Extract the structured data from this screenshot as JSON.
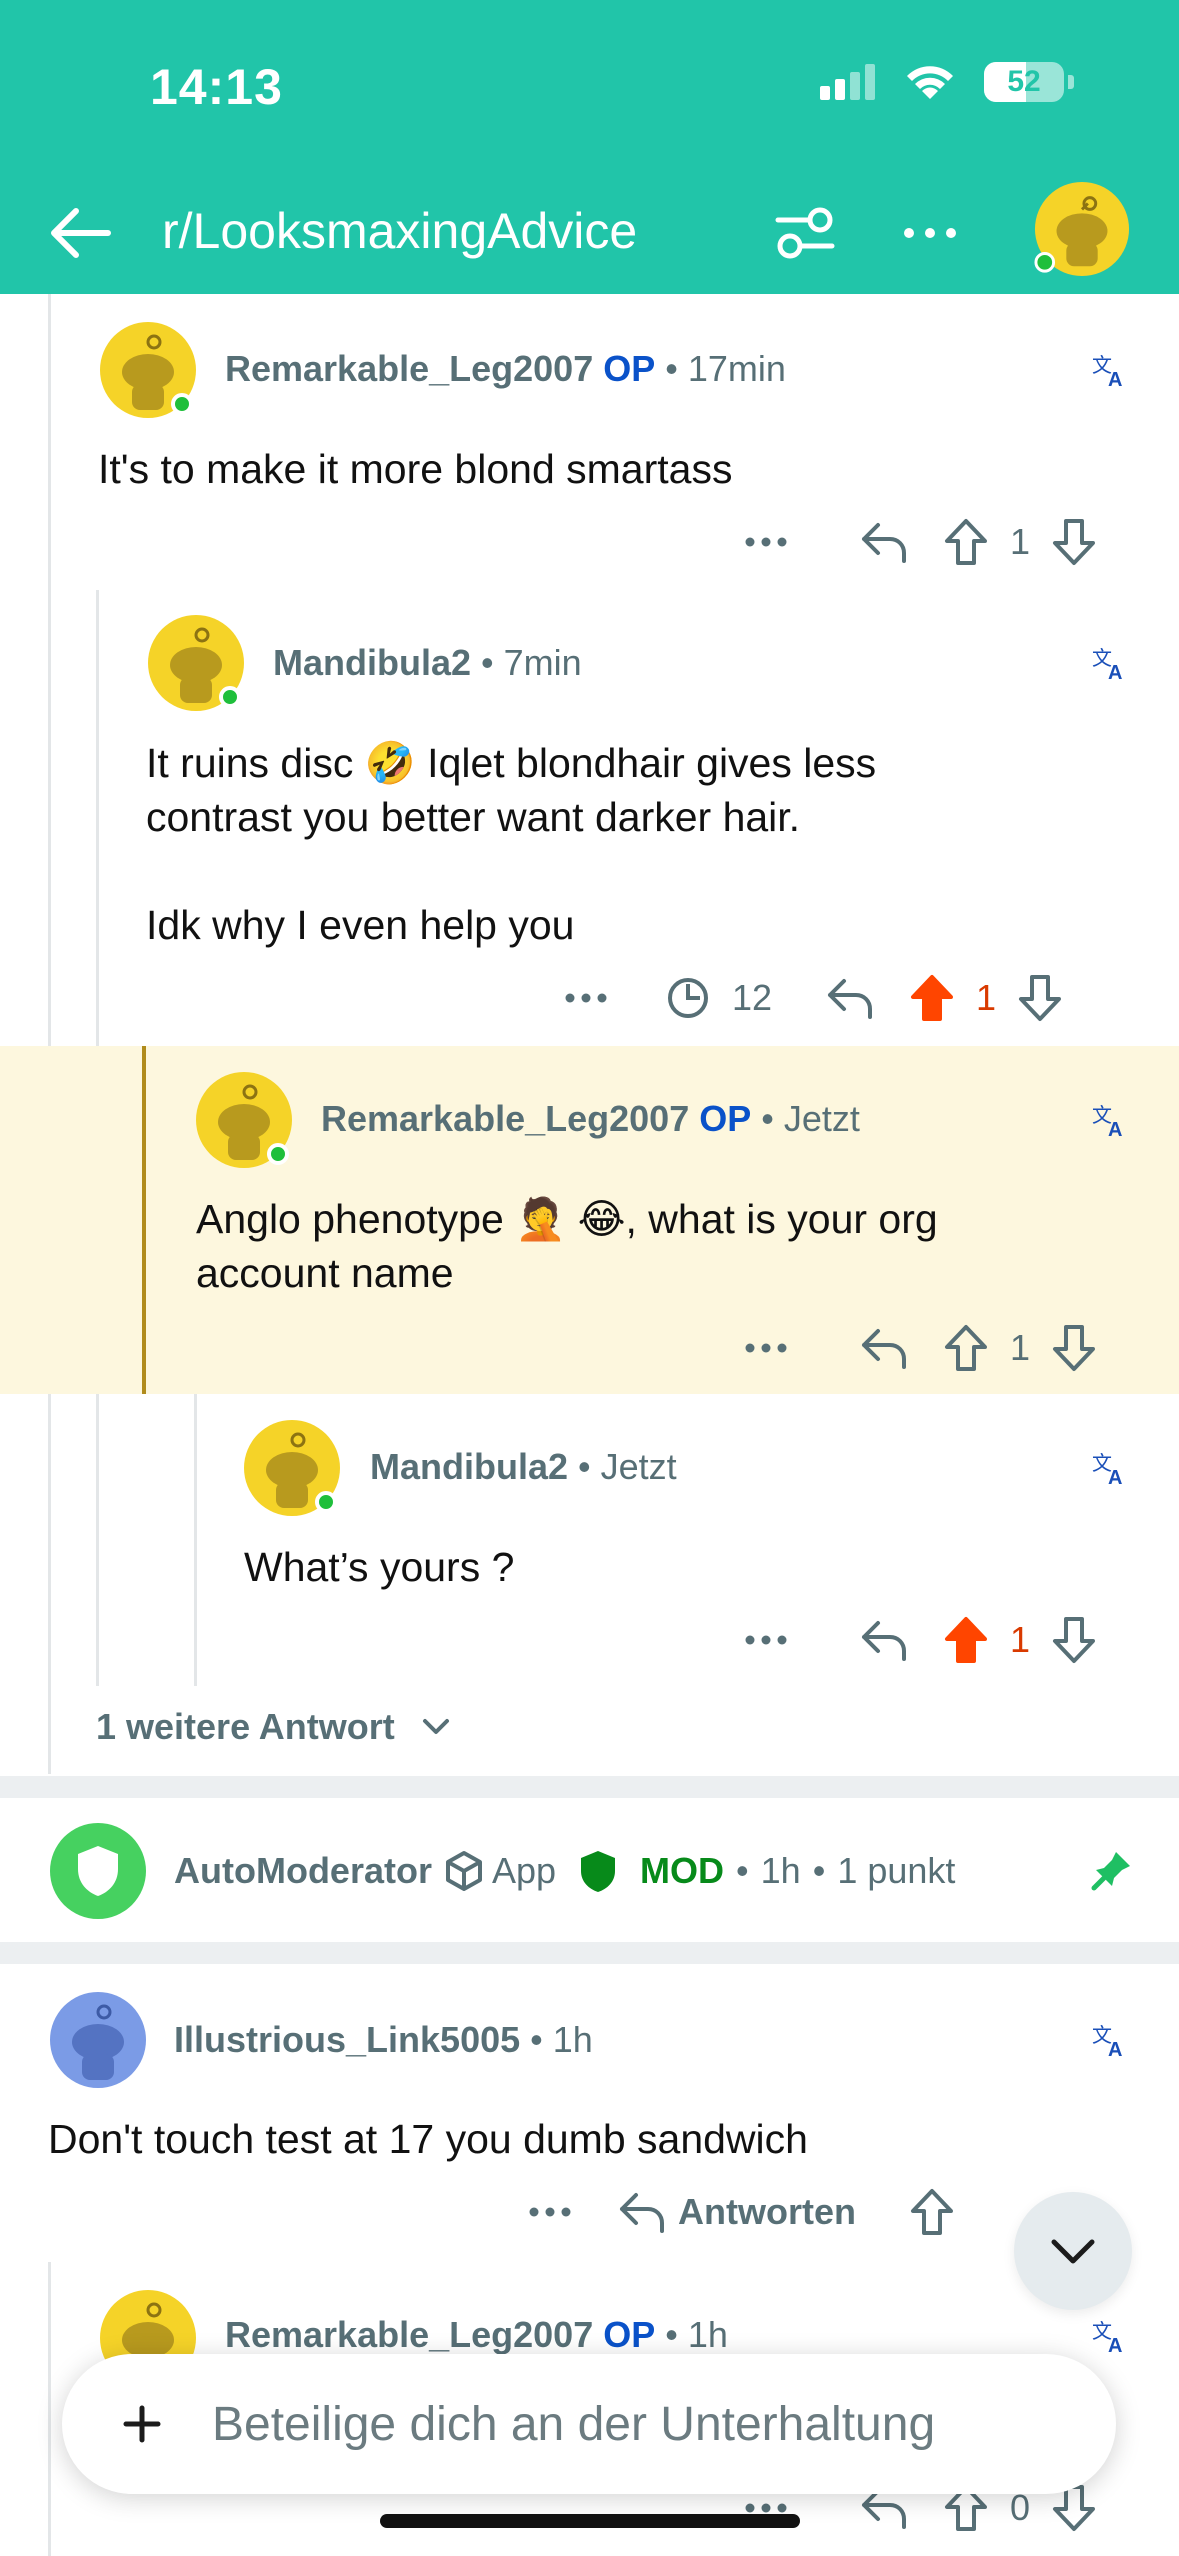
{
  "status": {
    "time": "14:13",
    "battery": "52"
  },
  "header": {
    "title": "r/LooksmaxingAdvice"
  },
  "comments": [
    {
      "user": "Remarkable_Leg2007",
      "op": "OP",
      "time": "17min",
      "text": "It's to make it more blond smartass",
      "votes": "1"
    },
    {
      "user": "Mandibula2",
      "time": "7min",
      "line1": "It ruins disc 🤣 Iqlet blondhair gives less",
      "line2": "contrast you better want darker hair.",
      "line3": "Idk why I even help you",
      "views": "12",
      "votes": "1"
    },
    {
      "user": "Remarkable_Leg2007",
      "op": "OP",
      "time": "Jetzt",
      "line1": "Anglo phenotype 🤦 😂, what is your org",
      "line2": "account name",
      "votes": "1"
    },
    {
      "user": "Mandibula2",
      "time": "Jetzt",
      "text": "What’s yours ?",
      "votes": "1"
    }
  ],
  "more_replies": "1 weitere Antwort",
  "automod": {
    "user": "AutoModerator",
    "app": "App",
    "mod": "MOD",
    "time": "1h",
    "points": "1 punkt"
  },
  "comment5": {
    "user": "Illustrious_Link5005",
    "time": "1h",
    "text": "Don't touch test at 17 you dumb sandwich",
    "reply": "Antworten"
  },
  "comment6": {
    "user": "Remarkable_Leg2007",
    "op": "OP",
    "time": "1h",
    "votes": "0"
  },
  "composer": {
    "placeholder": "Beteilige dich an der Unterhaltung"
  },
  "colors": {
    "header": "#21c5a9",
    "op": "#0a52c9",
    "upvote": "#ff4500",
    "mod": "#078a1a",
    "highlight": "#fdf7de"
  }
}
